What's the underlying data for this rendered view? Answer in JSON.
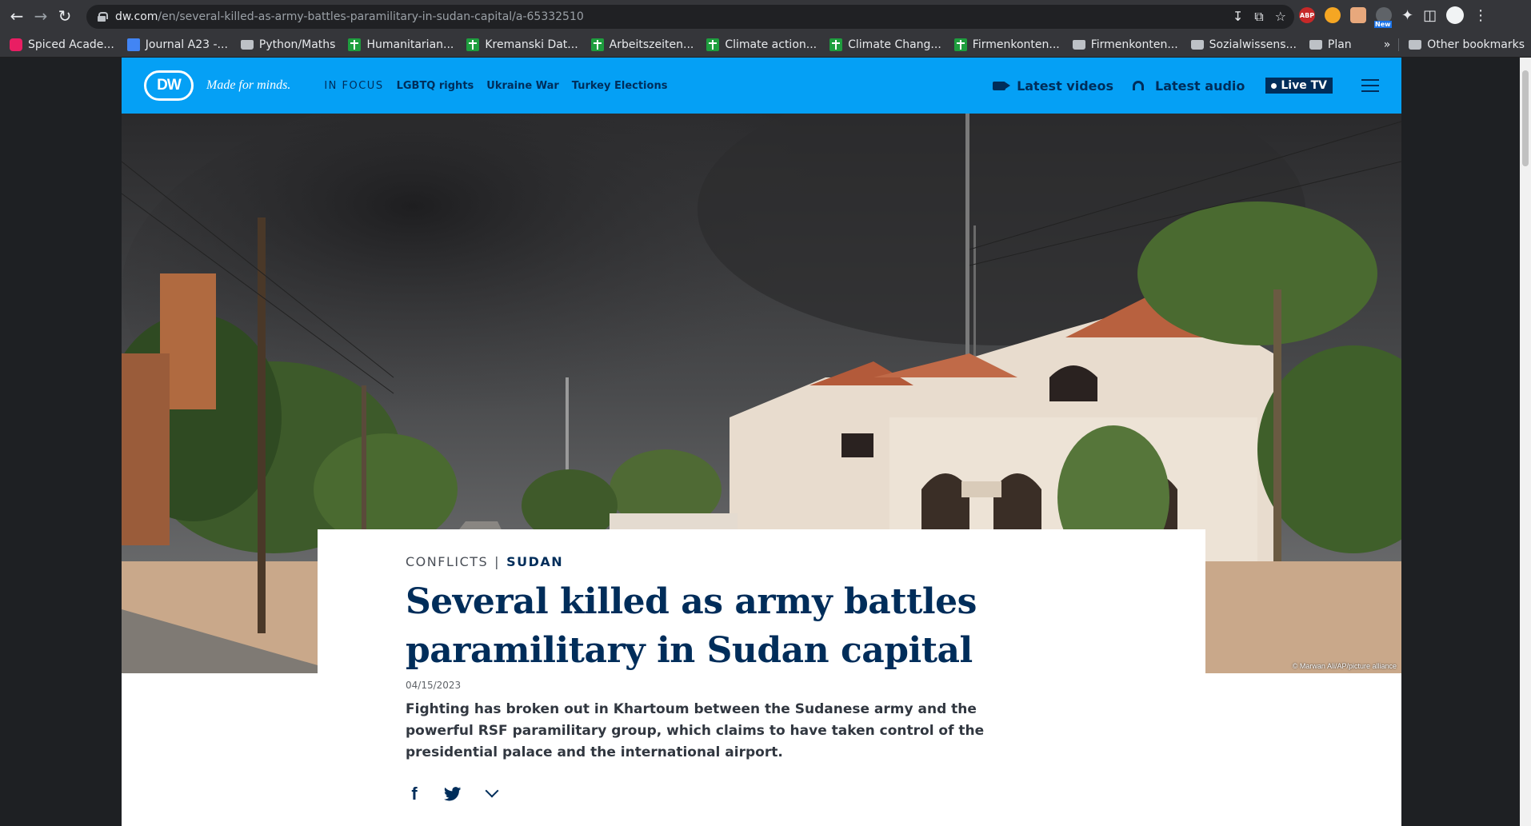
{
  "browser": {
    "url_host": "dw.com",
    "url_path": "/en/several-killed-as-army-battles-paramilitary-in-sudan-capital/a-65332510",
    "ext_badge_new": "New",
    "ext_abp": "ABP",
    "bookmarks": [
      {
        "label": "Spiced Acade...",
        "icon": "spiced"
      },
      {
        "label": "Journal A23 -...",
        "icon": "doc"
      },
      {
        "label": "Python/Maths",
        "icon": "folder"
      },
      {
        "label": "Humanitarian...",
        "icon": "green"
      },
      {
        "label": "Kremanski Dat...",
        "icon": "green"
      },
      {
        "label": "Arbeitszeiten...",
        "icon": "green"
      },
      {
        "label": "Climate action...",
        "icon": "green"
      },
      {
        "label": "Climate Chang...",
        "icon": "green"
      },
      {
        "label": "Firmenkonten...",
        "icon": "green"
      },
      {
        "label": "Firmenkonten...",
        "icon": "folder"
      },
      {
        "label": "Sozialwissens...",
        "icon": "folder"
      },
      {
        "label": "Plan",
        "icon": "folder"
      }
    ],
    "bookmarks_more": "»",
    "other_bookmarks": "Other bookmarks"
  },
  "header": {
    "logo": "DW",
    "tagline": "Made for minds.",
    "in_focus": "IN FOCUS",
    "focus_links": [
      "LGBTQ rights",
      "Ukraine War",
      "Turkey Elections"
    ],
    "latest_videos": "Latest videos",
    "latest_audio": "Latest audio",
    "live_tv": "Live TV"
  },
  "hero": {
    "credit": "© Marwan Ali/AP/picture alliance"
  },
  "article": {
    "category": "CONFLICTS",
    "separator": "|",
    "tag": "SUDAN",
    "headline": "Several killed as army battles paramilitary in Sudan capital",
    "date": "04/15/2023",
    "teaser": "Fighting has broken out in Khartoum between the Sudanese army and the powerful RSF paramilitary group, which claims to have taken control of the presidential palace and the international airport."
  },
  "share": {
    "facebook": "f"
  }
}
